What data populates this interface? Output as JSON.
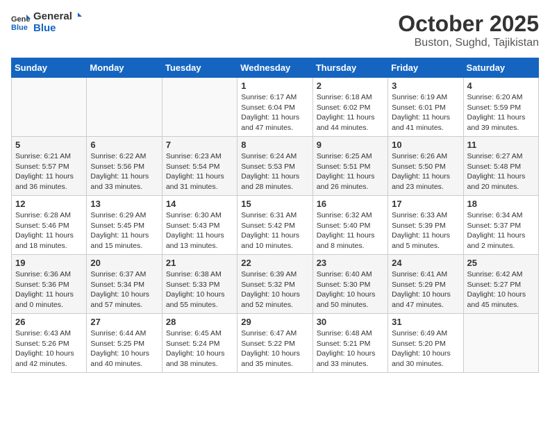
{
  "logo": {
    "general": "General",
    "blue": "Blue"
  },
  "title": "October 2025",
  "location": "Buston, Sughd, Tajikistan",
  "days_of_week": [
    "Sunday",
    "Monday",
    "Tuesday",
    "Wednesday",
    "Thursday",
    "Friday",
    "Saturday"
  ],
  "weeks": [
    [
      {
        "day": "",
        "info": ""
      },
      {
        "day": "",
        "info": ""
      },
      {
        "day": "",
        "info": ""
      },
      {
        "day": "1",
        "info": "Sunrise: 6:17 AM\nSunset: 6:04 PM\nDaylight: 11 hours and 47 minutes."
      },
      {
        "day": "2",
        "info": "Sunrise: 6:18 AM\nSunset: 6:02 PM\nDaylight: 11 hours and 44 minutes."
      },
      {
        "day": "3",
        "info": "Sunrise: 6:19 AM\nSunset: 6:01 PM\nDaylight: 11 hours and 41 minutes."
      },
      {
        "day": "4",
        "info": "Sunrise: 6:20 AM\nSunset: 5:59 PM\nDaylight: 11 hours and 39 minutes."
      }
    ],
    [
      {
        "day": "5",
        "info": "Sunrise: 6:21 AM\nSunset: 5:57 PM\nDaylight: 11 hours and 36 minutes."
      },
      {
        "day": "6",
        "info": "Sunrise: 6:22 AM\nSunset: 5:56 PM\nDaylight: 11 hours and 33 minutes."
      },
      {
        "day": "7",
        "info": "Sunrise: 6:23 AM\nSunset: 5:54 PM\nDaylight: 11 hours and 31 minutes."
      },
      {
        "day": "8",
        "info": "Sunrise: 6:24 AM\nSunset: 5:53 PM\nDaylight: 11 hours and 28 minutes."
      },
      {
        "day": "9",
        "info": "Sunrise: 6:25 AM\nSunset: 5:51 PM\nDaylight: 11 hours and 26 minutes."
      },
      {
        "day": "10",
        "info": "Sunrise: 6:26 AM\nSunset: 5:50 PM\nDaylight: 11 hours and 23 minutes."
      },
      {
        "day": "11",
        "info": "Sunrise: 6:27 AM\nSunset: 5:48 PM\nDaylight: 11 hours and 20 minutes."
      }
    ],
    [
      {
        "day": "12",
        "info": "Sunrise: 6:28 AM\nSunset: 5:46 PM\nDaylight: 11 hours and 18 minutes."
      },
      {
        "day": "13",
        "info": "Sunrise: 6:29 AM\nSunset: 5:45 PM\nDaylight: 11 hours and 15 minutes."
      },
      {
        "day": "14",
        "info": "Sunrise: 6:30 AM\nSunset: 5:43 PM\nDaylight: 11 hours and 13 minutes."
      },
      {
        "day": "15",
        "info": "Sunrise: 6:31 AM\nSunset: 5:42 PM\nDaylight: 11 hours and 10 minutes."
      },
      {
        "day": "16",
        "info": "Sunrise: 6:32 AM\nSunset: 5:40 PM\nDaylight: 11 hours and 8 minutes."
      },
      {
        "day": "17",
        "info": "Sunrise: 6:33 AM\nSunset: 5:39 PM\nDaylight: 11 hours and 5 minutes."
      },
      {
        "day": "18",
        "info": "Sunrise: 6:34 AM\nSunset: 5:37 PM\nDaylight: 11 hours and 2 minutes."
      }
    ],
    [
      {
        "day": "19",
        "info": "Sunrise: 6:36 AM\nSunset: 5:36 PM\nDaylight: 11 hours and 0 minutes."
      },
      {
        "day": "20",
        "info": "Sunrise: 6:37 AM\nSunset: 5:34 PM\nDaylight: 10 hours and 57 minutes."
      },
      {
        "day": "21",
        "info": "Sunrise: 6:38 AM\nSunset: 5:33 PM\nDaylight: 10 hours and 55 minutes."
      },
      {
        "day": "22",
        "info": "Sunrise: 6:39 AM\nSunset: 5:32 PM\nDaylight: 10 hours and 52 minutes."
      },
      {
        "day": "23",
        "info": "Sunrise: 6:40 AM\nSunset: 5:30 PM\nDaylight: 10 hours and 50 minutes."
      },
      {
        "day": "24",
        "info": "Sunrise: 6:41 AM\nSunset: 5:29 PM\nDaylight: 10 hours and 47 minutes."
      },
      {
        "day": "25",
        "info": "Sunrise: 6:42 AM\nSunset: 5:27 PM\nDaylight: 10 hours and 45 minutes."
      }
    ],
    [
      {
        "day": "26",
        "info": "Sunrise: 6:43 AM\nSunset: 5:26 PM\nDaylight: 10 hours and 42 minutes."
      },
      {
        "day": "27",
        "info": "Sunrise: 6:44 AM\nSunset: 5:25 PM\nDaylight: 10 hours and 40 minutes."
      },
      {
        "day": "28",
        "info": "Sunrise: 6:45 AM\nSunset: 5:24 PM\nDaylight: 10 hours and 38 minutes."
      },
      {
        "day": "29",
        "info": "Sunrise: 6:47 AM\nSunset: 5:22 PM\nDaylight: 10 hours and 35 minutes."
      },
      {
        "day": "30",
        "info": "Sunrise: 6:48 AM\nSunset: 5:21 PM\nDaylight: 10 hours and 33 minutes."
      },
      {
        "day": "31",
        "info": "Sunrise: 6:49 AM\nSunset: 5:20 PM\nDaylight: 10 hours and 30 minutes."
      },
      {
        "day": "",
        "info": ""
      }
    ]
  ]
}
